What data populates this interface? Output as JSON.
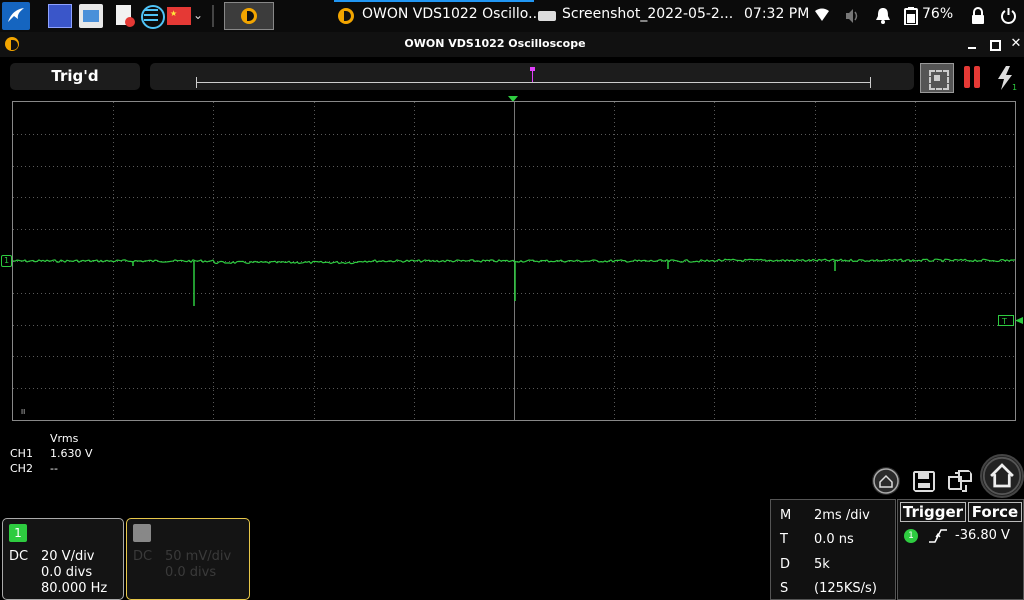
{
  "taskbar": {
    "task_scope": "OWON VDS1022 Oscillo...",
    "task_screenshot": "Screenshot_2022-05-2...",
    "clock": "07:32 PM",
    "battery": "76%"
  },
  "window": {
    "title": "OWON VDS1022 Oscilloscope"
  },
  "toolbar": {
    "trigger_status": "Trig'd"
  },
  "scope": {
    "ch1_marker": "1",
    "trig_marker": "T",
    "memory_mark": "II"
  },
  "measurements": {
    "header": "Vrms",
    "rows": [
      {
        "label": "CH1",
        "value": "1.630 V"
      },
      {
        "label": "CH2",
        "value": "--"
      }
    ]
  },
  "channels": [
    {
      "number": "1",
      "coupling": "DC",
      "scale": "20 V/div",
      "offset": "0.0 divs",
      "frequency": "80.000 Hz",
      "enabled": true
    },
    {
      "number": "2",
      "coupling": "DC",
      "scale": "50 mV/div",
      "offset": "0.0 divs",
      "frequency": "",
      "enabled": false
    }
  ],
  "horizontal": [
    {
      "key": "M",
      "value": "2ms /div"
    },
    {
      "key": "T",
      "value": "0.0 ns"
    },
    {
      "key": "D",
      "value": "5k"
    },
    {
      "key": "S",
      "value": "(125KS/s)"
    }
  ],
  "trigger": {
    "tab": "Trigger",
    "force": "Force",
    "source": "1",
    "level": "-36.80 V"
  },
  "colors": {
    "ch1": "#2ecc40",
    "grid": "#5a5a5a",
    "ch2_panel_border": "#e8c84a",
    "pause": "#e53935"
  }
}
